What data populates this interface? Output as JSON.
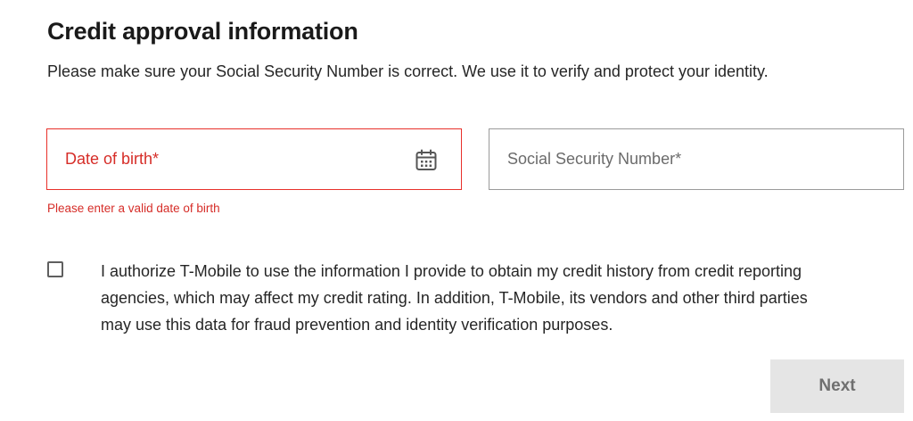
{
  "form": {
    "title": "Credit approval information",
    "subtitle": "Please make sure your Social Security Number is correct. We use it to verify and protect your identity.",
    "dob_field": {
      "label": "Date of birth*",
      "error": "Please enter a valid date of birth",
      "icon": "calendar-icon"
    },
    "ssn_field": {
      "label": "Social Security Number*"
    },
    "consent": {
      "checked": false,
      "text": "I authorize T-Mobile to use the information I provide to obtain my credit history from credit reporting agencies, which may affect my credit rating. In addition, T-Mobile, its vendors and other third parties may use this data for fraud prevention and identity verification purposes."
    },
    "next_label": "Next"
  },
  "colors": {
    "error": "#d62d28",
    "error_border": "#e8302a",
    "field_border": "#9a9a9a",
    "button_bg": "#e5e5e5",
    "button_text": "#6f6f6f"
  }
}
